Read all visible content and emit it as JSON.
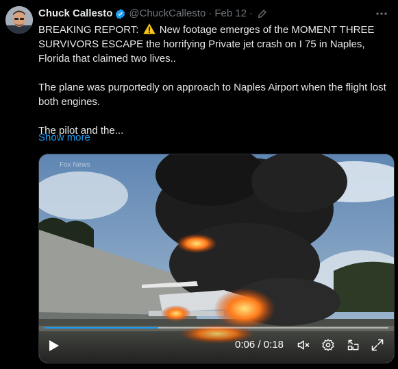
{
  "tweet": {
    "author_name": "Chuck Callesto",
    "handle": "@ChuckCallesto",
    "separator": "·",
    "date": "Feb 12",
    "lines": [
      "BREAKING REPORT:",
      "New footage  emerges of the MOMENT THREE SURVIVORS ESCAPE the horrifying Private jet crash on I 75 in Naples, Florida that claimed two lives..",
      "The plane was purportedly on approach to Naples Airport when the flight lost both engines.",
      "The pilot and the..."
    ],
    "show_more": "Show more"
  },
  "video": {
    "watermark": "Fox News",
    "time_current": "0:06",
    "time_separator": " / ",
    "time_total": "0:18",
    "progress": 0.33
  },
  "icons": {
    "verified": "verified-badge-icon",
    "edit": "edited-pencil-icon",
    "more": "more-options-icon",
    "warning": "warning-emoji-icon",
    "play": "play-icon",
    "mute": "mute-icon",
    "settings": "settings-gear-icon",
    "pip": "picture-in-picture-icon",
    "fullscreen": "fullscreen-icon"
  },
  "colors": {
    "accent": "#1d9bf0",
    "text": "#e7e9ea",
    "muted": "#71767b",
    "background": "#000000"
  }
}
